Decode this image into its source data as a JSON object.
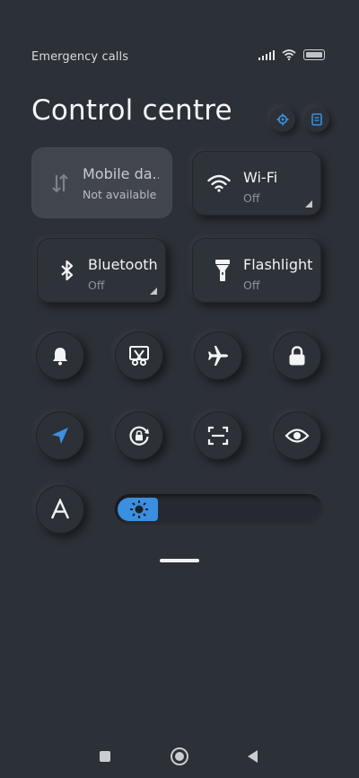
{
  "status_bar": {
    "text": "Emergency calls o"
  },
  "header": {
    "title": "Control centre"
  },
  "tiles": [
    {
      "name": "Mobile da...",
      "sub": "Not available"
    },
    {
      "name": "Wi-Fi",
      "sub": "Off"
    },
    {
      "name": "Bluetooth",
      "sub": "Off"
    },
    {
      "name": "Flashlight",
      "sub": "Off"
    }
  ],
  "toggles": [
    "bell-icon",
    "screenshot-scissors-icon",
    "airplane-icon",
    "lock-icon",
    "location-arrow-icon",
    "rotation-lock-icon",
    "scan-frame-icon",
    "eye-icon",
    "auto-brightness-icon"
  ],
  "brightness": {
    "level": 0.2,
    "auto_label": "A"
  },
  "colors": {
    "accent": "#3a8fe0",
    "background": "#2c3037",
    "tile_disabled": "#41454d"
  }
}
